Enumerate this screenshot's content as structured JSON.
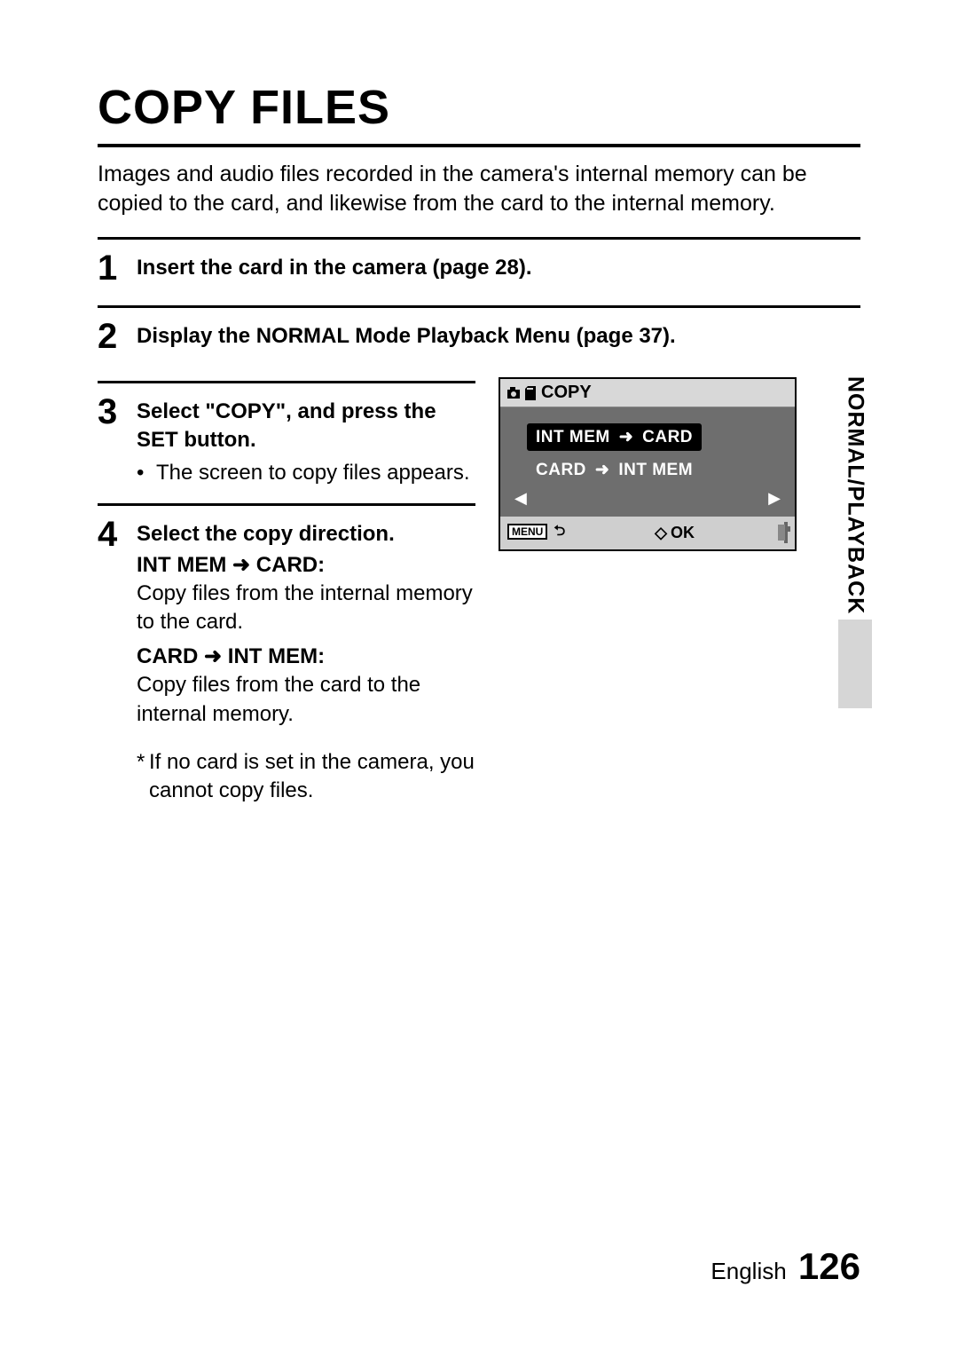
{
  "title": "COPY FILES",
  "intro": "Images and audio files recorded in the camera's internal memory can be copied to the card, and likewise from the card to the internal memory.",
  "steps": {
    "s1": {
      "num": "1",
      "heading": "Insert the card in the camera (page 28)."
    },
    "s2": {
      "num": "2",
      "heading": "Display the NORMAL Mode Playback Menu (page 37)."
    },
    "s3": {
      "num": "3",
      "heading": "Select \"COPY\", and press the SET button.",
      "bullet": "The screen to copy files appears."
    },
    "s4": {
      "num": "4",
      "heading": "Select the copy direction.",
      "dir1_label_a": "INT MEM",
      "dir1_label_b": "CARD:",
      "dir1_desc": "Copy files from the internal memory to the card.",
      "dir2_label_a": "CARD",
      "dir2_label_b": "INT MEM:",
      "dir2_desc": "Copy files from the card to the internal memory.",
      "note": "If no card is set in the camera, you cannot copy files."
    }
  },
  "lcd": {
    "title": "COPY",
    "opt1_a": "INT MEM",
    "opt1_b": "CARD",
    "opt2_a": "CARD",
    "opt2_b": "INT MEM",
    "nav_left": "◀",
    "nav_right": "▶",
    "menu": "MENU",
    "ok": "OK"
  },
  "side_tab": "NORMAL/PLAYBACK",
  "footer": {
    "lang": "English",
    "page": "126"
  },
  "glyphs": {
    "arrow": "➜",
    "bullet": "•",
    "ast": "*",
    "back": "⮌",
    "diamond": "◇"
  }
}
